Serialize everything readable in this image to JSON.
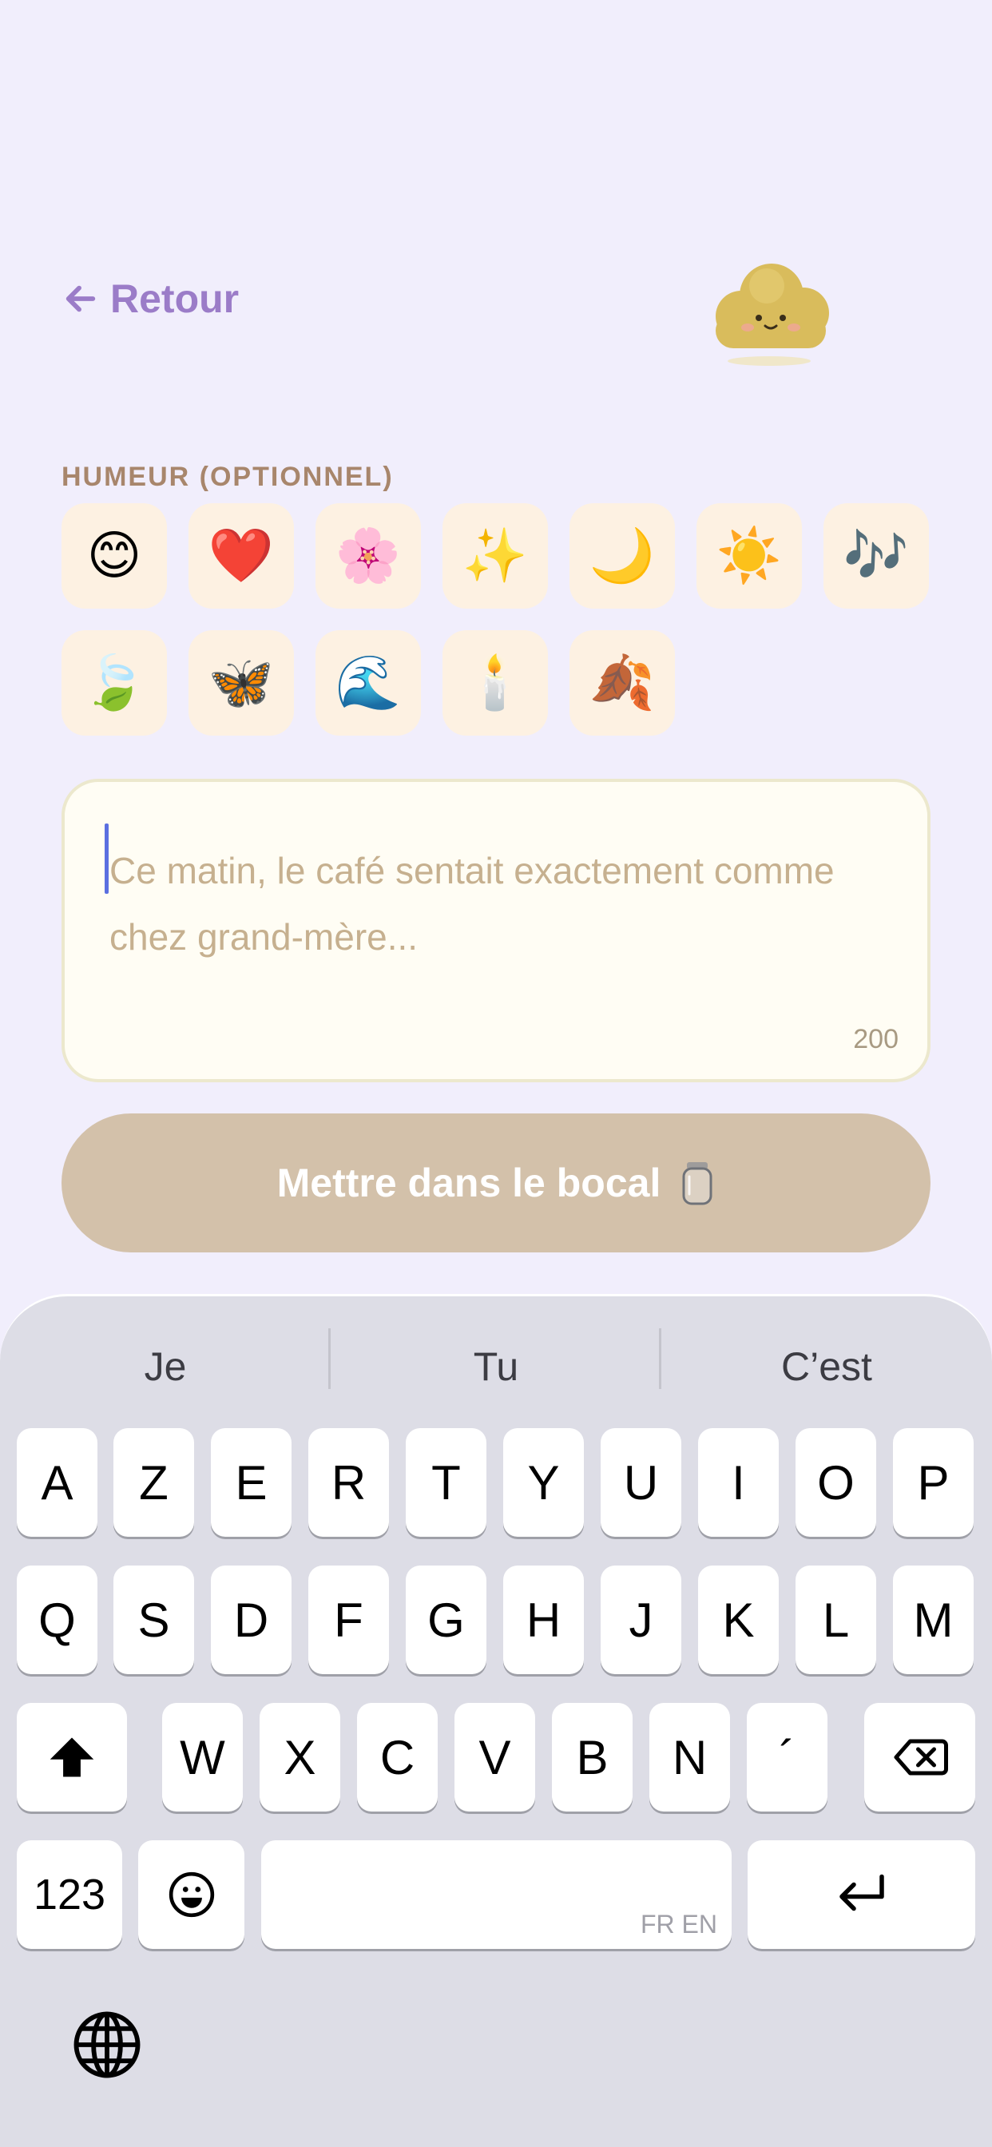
{
  "header": {
    "back_label": "Retour"
  },
  "mood": {
    "label": "HUMEUR (OPTIONNEL)",
    "chips": [
      {
        "emoji": "😊",
        "name": "smile"
      },
      {
        "emoji": "❤️",
        "name": "heart"
      },
      {
        "emoji": "🌸",
        "name": "blossom"
      },
      {
        "emoji": "✨",
        "name": "sparkles"
      },
      {
        "emoji": "🌙",
        "name": "moon"
      },
      {
        "emoji": "☀️",
        "name": "sun"
      },
      {
        "emoji": "🎶",
        "name": "music"
      },
      {
        "emoji": "🍃",
        "name": "leaf"
      },
      {
        "emoji": "🦋",
        "name": "butterfly"
      },
      {
        "emoji": "🌊",
        "name": "wave"
      },
      {
        "emoji": "🕯️",
        "name": "candle"
      },
      {
        "emoji": "🍂",
        "name": "fallen-leaf"
      }
    ]
  },
  "note": {
    "placeholder": "Ce matin, le café sentait exactement comme chez grand-mère...",
    "char_count": "200"
  },
  "submit": {
    "label": "Mettre dans le bocal"
  },
  "keyboard": {
    "suggestions": [
      "Je",
      "Tu",
      "C’est"
    ],
    "row1": [
      "A",
      "Z",
      "E",
      "R",
      "T",
      "Y",
      "U",
      "I",
      "O",
      "P"
    ],
    "row2": [
      "Q",
      "S",
      "D",
      "F",
      "G",
      "H",
      "J",
      "K",
      "L",
      "M"
    ],
    "row3": [
      "W",
      "X",
      "C",
      "V",
      "B",
      "N",
      "´"
    ],
    "numbers_label": "123",
    "space_languages": "FR EN"
  },
  "colors": {
    "background": "#f1eefc",
    "accent": "#9b7cc8",
    "chip": "#fdf1e2",
    "submit": "#d3c1aa",
    "caret": "#5b6fe0"
  }
}
